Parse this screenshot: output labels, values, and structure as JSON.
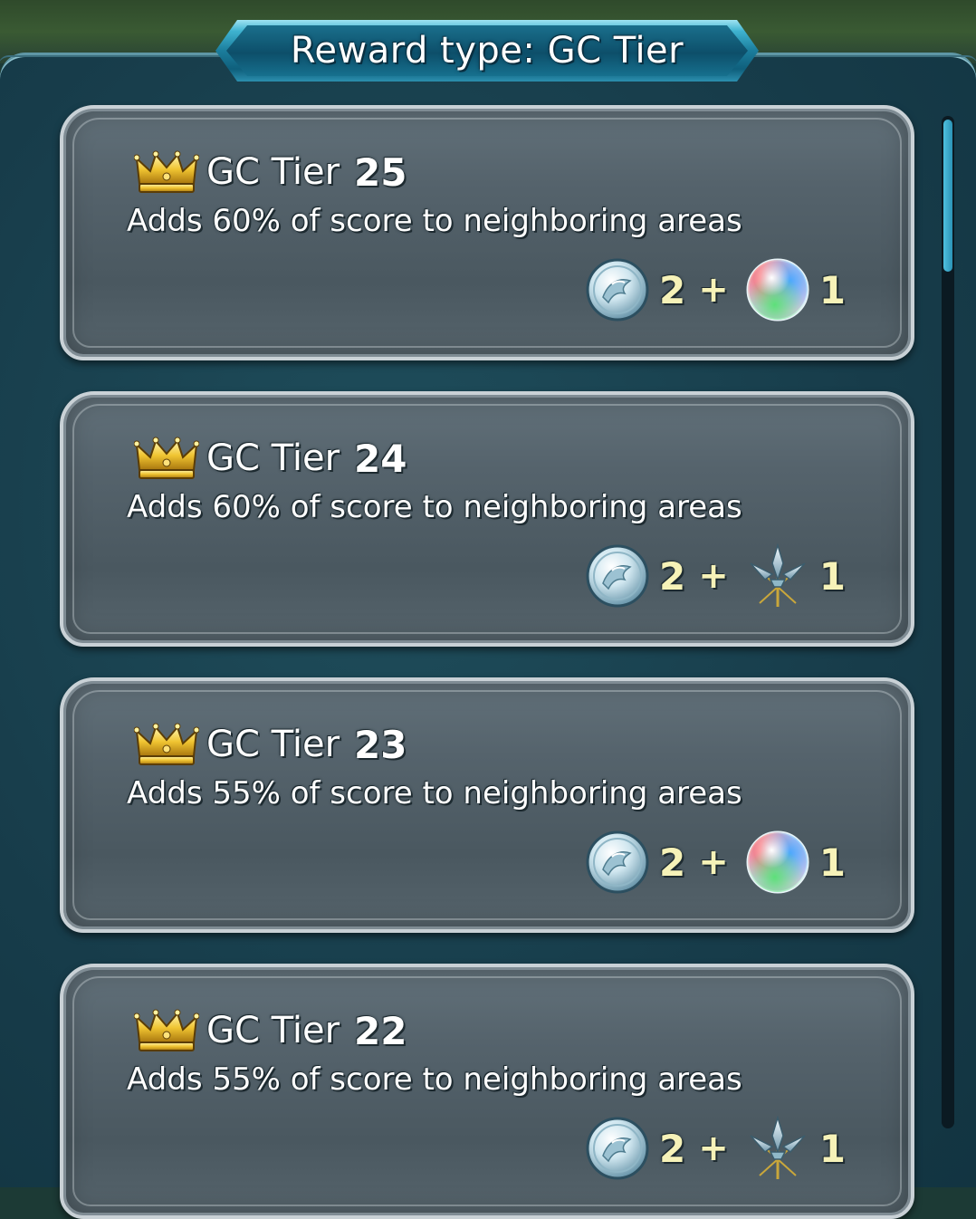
{
  "header": {
    "title": "Reward type: GC Tier"
  },
  "rewards": [
    {
      "label": "GC Tier",
      "tier": "25",
      "description": "Adds 60% of score to neighboring areas",
      "items": [
        {
          "icon": "divine-dew-icon",
          "qty": "2"
        },
        {
          "icon": "rainbow-orb-icon",
          "qty": "1"
        }
      ]
    },
    {
      "label": "GC Tier",
      "tier": "24",
      "description": "Adds 60% of score to neighboring areas",
      "items": [
        {
          "icon": "divine-dew-icon",
          "qty": "2"
        },
        {
          "icon": "trident-icon",
          "qty": "1"
        }
      ]
    },
    {
      "label": "GC Tier",
      "tier": "23",
      "description": "Adds 55% of score to neighboring areas",
      "items": [
        {
          "icon": "divine-dew-icon",
          "qty": "2"
        },
        {
          "icon": "rainbow-orb-icon",
          "qty": "1"
        }
      ]
    },
    {
      "label": "GC Tier",
      "tier": "22",
      "description": "Adds 55% of score to neighboring areas",
      "items": [
        {
          "icon": "divine-dew-icon",
          "qty": "2"
        },
        {
          "icon": "trident-icon",
          "qty": "1"
        }
      ]
    }
  ],
  "plus_sign": "+",
  "colors": {
    "panel": "#173c4a",
    "banner": "#1b7d9c",
    "card": "#55636c",
    "qty_text": "#f6f2b8",
    "scroll_thumb": "#4fc0de"
  }
}
